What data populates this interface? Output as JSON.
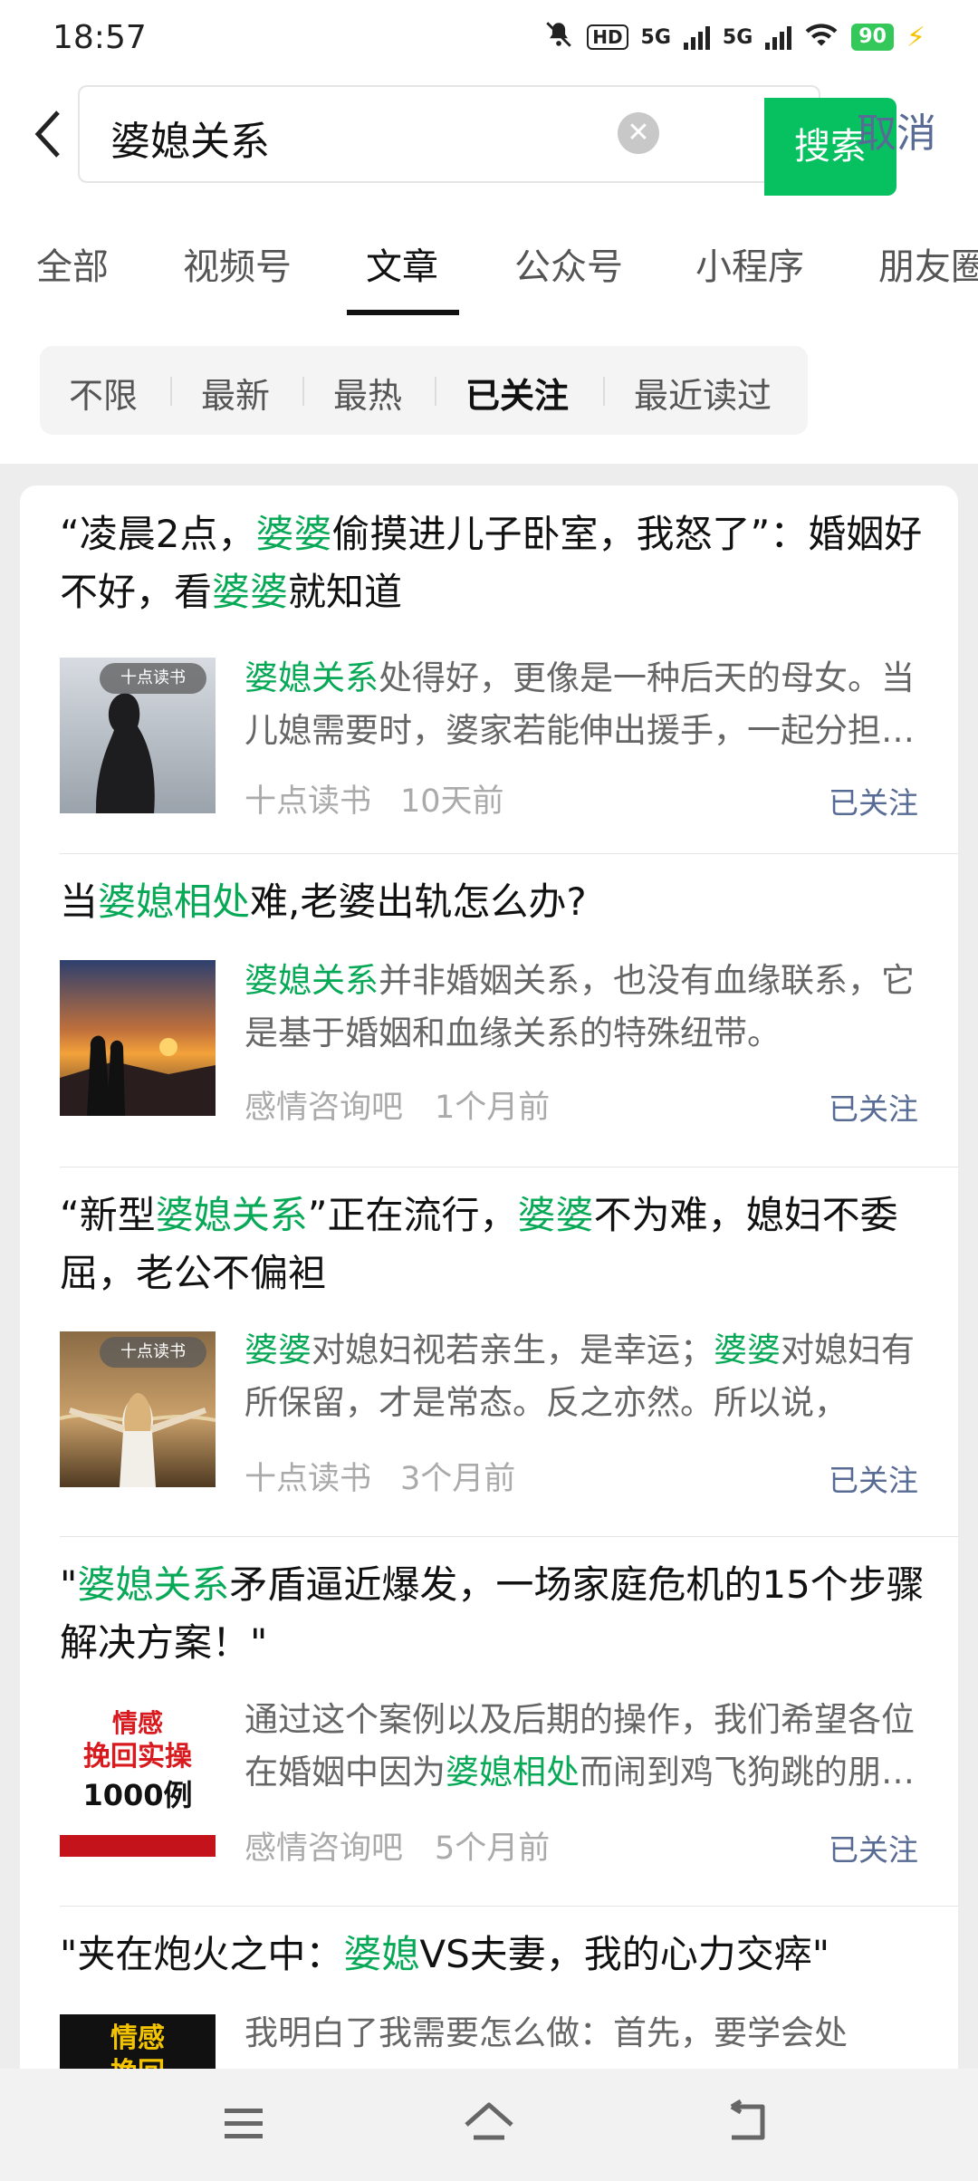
{
  "status_bar": {
    "time": "18:57",
    "hd_label": "HD",
    "network1": "5G",
    "network2": "5G",
    "battery": "90"
  },
  "search": {
    "query": "婆媳关系",
    "search_button": "搜索",
    "cancel_button": "取消"
  },
  "tabs": [
    {
      "label": "全部",
      "active": false
    },
    {
      "label": "视频号",
      "active": false
    },
    {
      "label": "文章",
      "active": true
    },
    {
      "label": "公众号",
      "active": false
    },
    {
      "label": "小程序",
      "active": false
    },
    {
      "label": "朋友圈",
      "active": false
    }
  ],
  "filters": [
    {
      "label": "不限",
      "active": false
    },
    {
      "label": "最新",
      "active": false
    },
    {
      "label": "最热",
      "active": false
    },
    {
      "label": "已关注",
      "active": true
    },
    {
      "label": "最近读过",
      "active": false
    }
  ],
  "results": [
    {
      "title_parts": [
        "“凌晨2点，",
        "婆婆",
        "偷摸进儿子卧室，我怒了”：婚姻好不好，看",
        "婆婆",
        "就知道"
      ],
      "snippet_parts": [
        "婆媳关系",
        "处得好，更像是一种后天的母女。当儿媳需要时，婆家若能伸出援手，一起分担，实属幸运。"
      ],
      "thumb_badge": "十点读书",
      "source": "十点读书",
      "time": "10天前",
      "follow_status": "已关注"
    },
    {
      "title_parts": [
        "当",
        "婆媳相处",
        "难,老婆出轨怎么办?"
      ],
      "snippet_parts": [
        "婆媳关系",
        "并非婚姻关系，也没有血缘联系，它是基于婚姻和血缘关系的特殊纽带。"
      ],
      "thumb_badge": "",
      "source": "感情咨询吧",
      "time": "1个月前",
      "follow_status": "已关注"
    },
    {
      "title_parts": [
        "“新型",
        "婆媳关系",
        "”正在流行，",
        "婆婆",
        "不为难，媳妇不委屈，老公不偏袒"
      ],
      "snippet_parts": [
        "婆婆",
        "对媳妇视若亲生，是幸运；",
        "婆婆",
        "对媳妇有所保留，才是常态。反之亦然。所以说，"
      ],
      "thumb_badge": "十点读书",
      "source": "十点读书",
      "time": "3个月前",
      "follow_status": "已关注"
    },
    {
      "title_parts": [
        "\"",
        "婆媳关系",
        "矛盾逼近爆发，一场家庭危机的15个步骤解决方案！\""
      ],
      "snippet_parts": [
        "通过这个案例以及后期的操作，我们希望各位在婚姻中因为",
        "婆媳相处",
        "而闹到鸡飞狗跳的朋友们"
      ],
      "thumb_text": [
        "情感",
        "挽回实操",
        "1000例"
      ],
      "source": "感情咨询吧",
      "time": "5个月前",
      "follow_status": "已关注"
    },
    {
      "title_parts": [
        "\"夹在炮火之中：",
        "婆媳",
        "VS夫妻，我的心力交瘁\""
      ],
      "snippet_parts": [
        "我明白了我需要怎么做：首先，要学会处"
      ],
      "thumb_text": [
        "情感",
        "挽回"
      ]
    }
  ],
  "icons": {
    "back": "chevron-left-icon",
    "clear": "clear-icon",
    "menu": "menu-icon",
    "home": "home-icon",
    "back_nav": "back-icon"
  }
}
